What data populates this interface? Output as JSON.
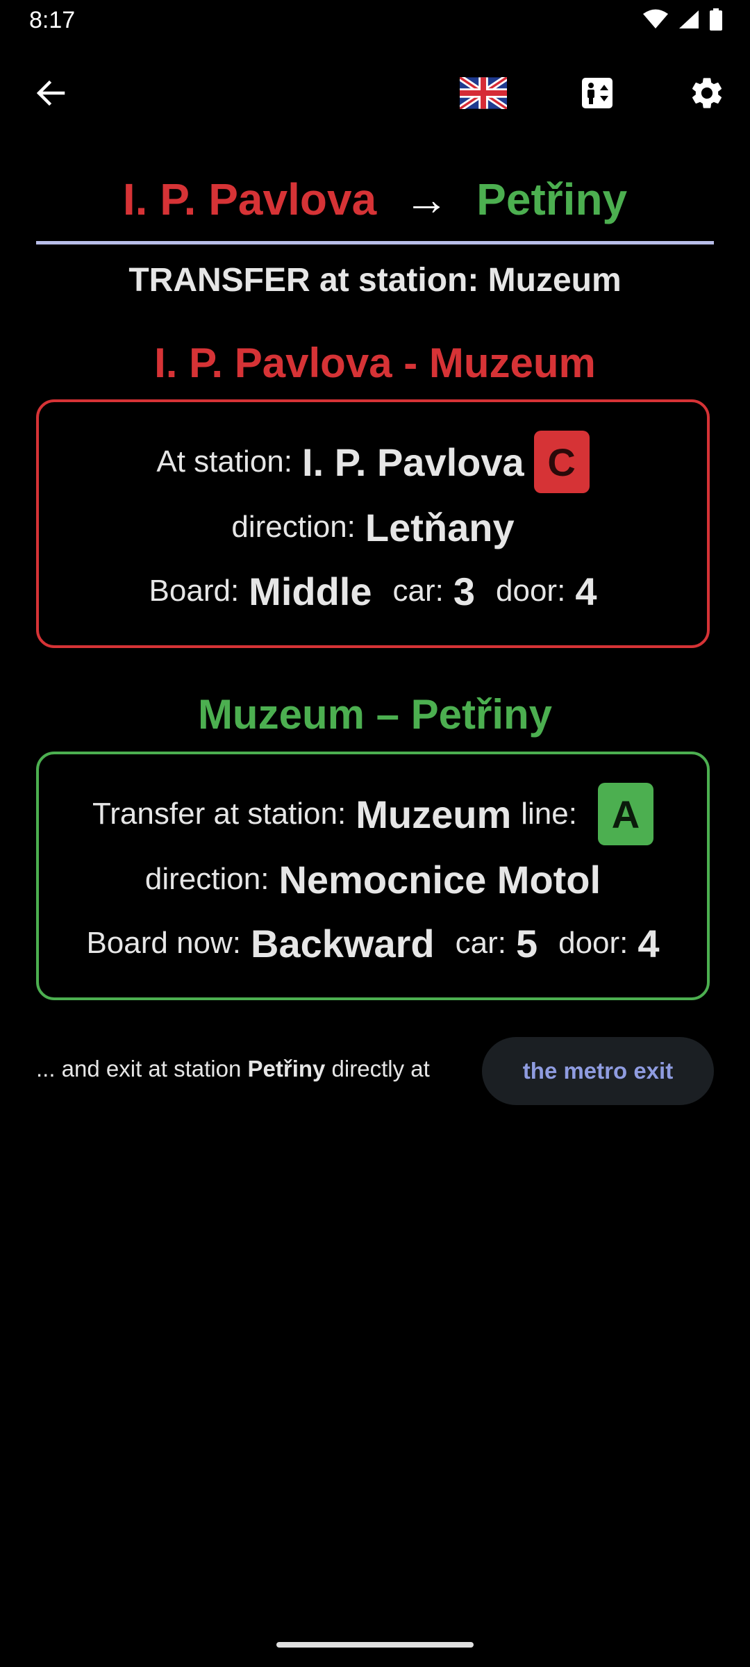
{
  "status_bar": {
    "time": "8:17",
    "icons": [
      "wifi-icon",
      "signal-icon",
      "battery-icon"
    ]
  },
  "app_bar": {
    "icons": [
      "back-arrow-icon",
      "uk-flag-icon",
      "elevator-icon",
      "gear-icon"
    ]
  },
  "route": {
    "from": "I. P. Pavlova",
    "arrow": "→",
    "to": "Petřiny",
    "transfer_heading": "TRANSFER at station: Muzeum"
  },
  "leg1": {
    "title": "I. P. Pavlova - Muzeum",
    "station_label": "At station:",
    "station": "I. P. Pavlova",
    "line": "C",
    "direction_label": "direction:",
    "direction": "Letňany",
    "board_label": "Board:",
    "board": "Middle",
    "car_label": "car:",
    "car": "3",
    "door_label": "door:",
    "door": "4"
  },
  "leg2": {
    "title": "Muzeum – Petřiny",
    "station_label": "Transfer at station:",
    "station": "Muzeum",
    "line_label": "line:",
    "line": "A",
    "direction_label": "direction:",
    "direction": "Nemocnice Motol",
    "board_label": "Board now:",
    "board": "Backward",
    "car_label": "car:",
    "car": "5",
    "door_label": "door:",
    "door": "4"
  },
  "exit": {
    "prefix": "... and exit at station ",
    "station": "Petřiny",
    "suffix": " directly at",
    "button": "the metro exit"
  },
  "colors": {
    "line_c": "#d63336",
    "line_a": "#4caf50",
    "divider": "#b8bde8",
    "exit_button_text": "#8f9ce0"
  }
}
